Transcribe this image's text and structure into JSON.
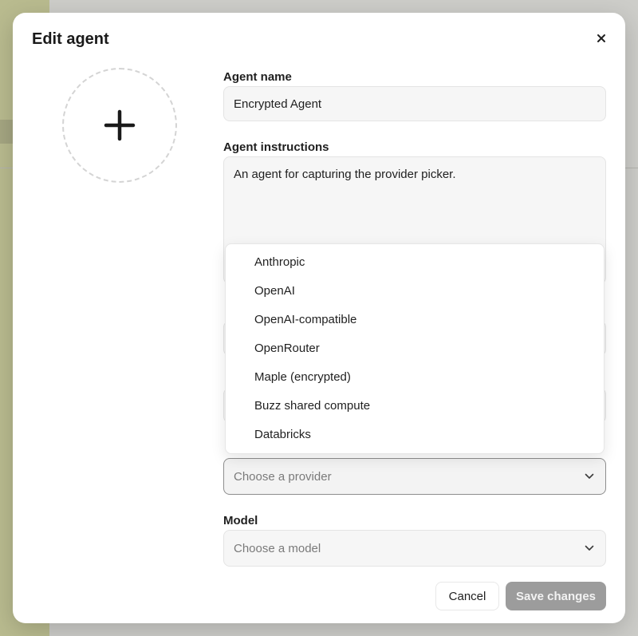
{
  "modal": {
    "title": "Edit agent",
    "close_icon": "close-icon",
    "avatar_icon": "plus-icon"
  },
  "fields": {
    "name_label": "Agent name",
    "name_value": "Encrypted Agent",
    "instructions_label": "Agent instructions",
    "instructions_value": "An agent for capturing the provider picker.",
    "provider_placeholder": "Choose a provider",
    "model_label": "Model",
    "model_placeholder": "Choose a model"
  },
  "dropdown": {
    "options": [
      "Anthropic",
      "OpenAI",
      "OpenAI-compatible",
      "OpenRouter",
      "Maple (encrypted)",
      "Buzz shared compute",
      "Databricks"
    ]
  },
  "actions": {
    "cancel_label": "Cancel",
    "save_label": "Save changes"
  },
  "colors": {
    "save_disabled": "#9c9c9c",
    "modal_bg": "#ffffff"
  }
}
